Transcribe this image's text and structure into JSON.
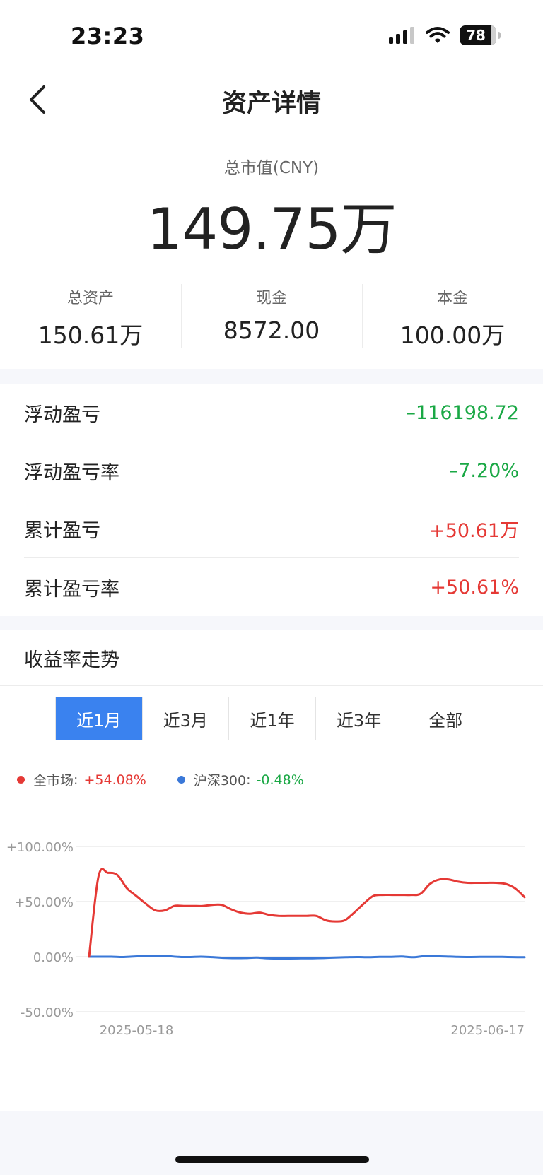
{
  "status": {
    "time": "23:23",
    "battery": "78"
  },
  "nav": {
    "title": "资产详情"
  },
  "summary": {
    "label": "总市值(CNY)",
    "value": "149.75万"
  },
  "stats": [
    {
      "label": "总资产",
      "value": "150.61万"
    },
    {
      "label": "现金",
      "value": "8572.00"
    },
    {
      "label": "本金",
      "value": "100.00万"
    }
  ],
  "pnl": [
    {
      "label": "浮动盈亏",
      "value": "–116198.72",
      "trend": "down"
    },
    {
      "label": "浮动盈亏率",
      "value": "–7.20%",
      "trend": "down"
    },
    {
      "label": "累计盈亏",
      "value": "+50.61万",
      "trend": "up"
    },
    {
      "label": "累计盈亏率",
      "value": "+50.61%",
      "trend": "up"
    }
  ],
  "trend": {
    "title": "收益率走势",
    "tabs": [
      "近1月",
      "近3月",
      "近1年",
      "近3年",
      "全部"
    ],
    "active_tab": 0
  },
  "colors": {
    "up": "#e53935",
    "down": "#1aa845",
    "accent": "#3a82ef",
    "series_market": "#e53935",
    "series_index": "#3a78d8"
  },
  "chart_data": {
    "type": "line",
    "x_labels": [
      "2025-05-18",
      "2025-06-17"
    ],
    "ylim": [
      -50,
      100
    ],
    "y_ticks": [
      100,
      50,
      0,
      -50
    ],
    "y_tick_labels": [
      "+100.00%",
      "+50.00%",
      "0.00%",
      "-50.00%"
    ],
    "grid": true,
    "legend_position": "top-left",
    "series": [
      {
        "name": "全市场",
        "legend_value": "+54.08%",
        "color": "#e53935",
        "values": [
          0,
          73,
          76,
          74,
          62,
          55,
          48,
          42,
          42,
          46,
          46,
          46,
          46,
          47,
          47,
          43,
          40,
          39,
          40,
          38,
          37,
          37,
          37,
          37,
          37,
          33,
          32,
          33,
          40,
          48,
          55,
          56,
          56,
          56,
          56,
          57,
          66,
          70,
          70,
          68,
          67,
          67,
          67,
          67,
          66,
          62,
          54
        ]
      },
      {
        "name": "沪深300",
        "legend_value": "-0.48%",
        "color": "#3a78d8",
        "values": [
          0,
          0,
          0,
          -0.3,
          0.2,
          0.6,
          0.8,
          0.6,
          -0.2,
          -0.3,
          0,
          -0.4,
          -1,
          -1.3,
          -1.2,
          -0.8,
          -1.5,
          -1.6,
          -1.6,
          -1.5,
          -1.4,
          -1.2,
          -0.8,
          -0.5,
          -0.3,
          -0.5,
          -0.2,
          -0.1,
          0.2,
          -0.5,
          0.5,
          0.5,
          0.2,
          -0.2,
          -0.3,
          -0.2,
          -0.1,
          -0.2,
          -0.4,
          -0.5
        ]
      }
    ]
  }
}
